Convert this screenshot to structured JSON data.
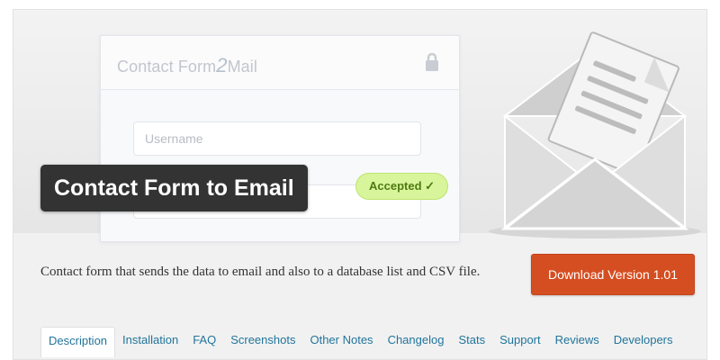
{
  "banner": {
    "brand_prefix": "Contact Form",
    "brand_two": "2",
    "brand_suffix": "Mail",
    "username_placeholder": "Username",
    "accepted_label": "Accepted ✓",
    "title": "Contact Form to Email"
  },
  "plugin": {
    "description": "Contact form that sends the data to email and also to a database list and CSV file.",
    "download_label": "Download Version 1.01"
  },
  "tabs": [
    {
      "label": "Description",
      "active": true
    },
    {
      "label": "Installation"
    },
    {
      "label": "FAQ"
    },
    {
      "label": "Screenshots"
    },
    {
      "label": "Other Notes"
    },
    {
      "label": "Changelog"
    },
    {
      "label": "Stats"
    },
    {
      "label": "Support"
    },
    {
      "label": "Reviews"
    },
    {
      "label": "Developers"
    }
  ],
  "icons": [
    "lock-icon",
    "envelope-icon",
    "check-icon"
  ],
  "colors": {
    "download_button": "#d54e21",
    "tab_link": "#21759b",
    "accepted_bg": "#d8f59b",
    "title_badge_bg": "#333333"
  }
}
